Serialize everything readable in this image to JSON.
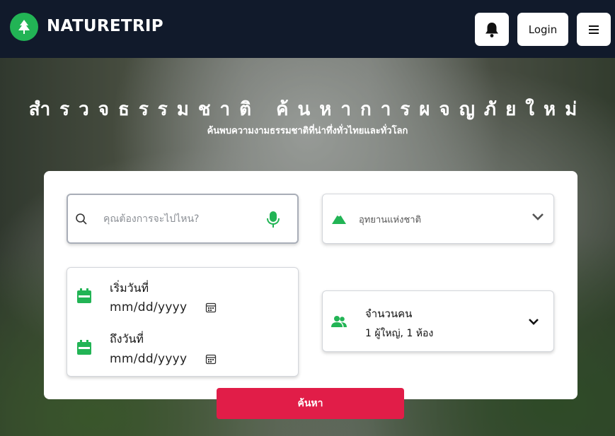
{
  "header": {
    "brand": "NATURETRIP",
    "login_label": "Login",
    "icons": [
      "tree-logo-icon",
      "bell-icon",
      "hamburger-menu-icon"
    ]
  },
  "hero": {
    "title": "สำรวจธรรมชาติ ค้นหาการผจญภัยใหม่",
    "subtitle": "ค้นพบความงามธรรมชาติที่น่าทึ่งทั่วไทยและทั่วโลก"
  },
  "search": {
    "placeholder": "คุณต้องการจะไปไหน?",
    "value": ""
  },
  "park_select": {
    "selected": "อุทยานแห่งชาติ"
  },
  "dates": {
    "start_label": "เริ่มวันที่",
    "start_value": "mm/dd/yyyy",
    "end_label": "ถึงวันที่",
    "end_value": "mm/dd/yyyy"
  },
  "guests": {
    "title": "จำนวนคน",
    "value": "1 ผู้ใหญ่,   1 ห้อง"
  },
  "submit_label": "ค้นหา",
  "colors": {
    "header_bg": "#111a2b",
    "accent_green": "#22b455",
    "submit_red": "#e11d48"
  }
}
